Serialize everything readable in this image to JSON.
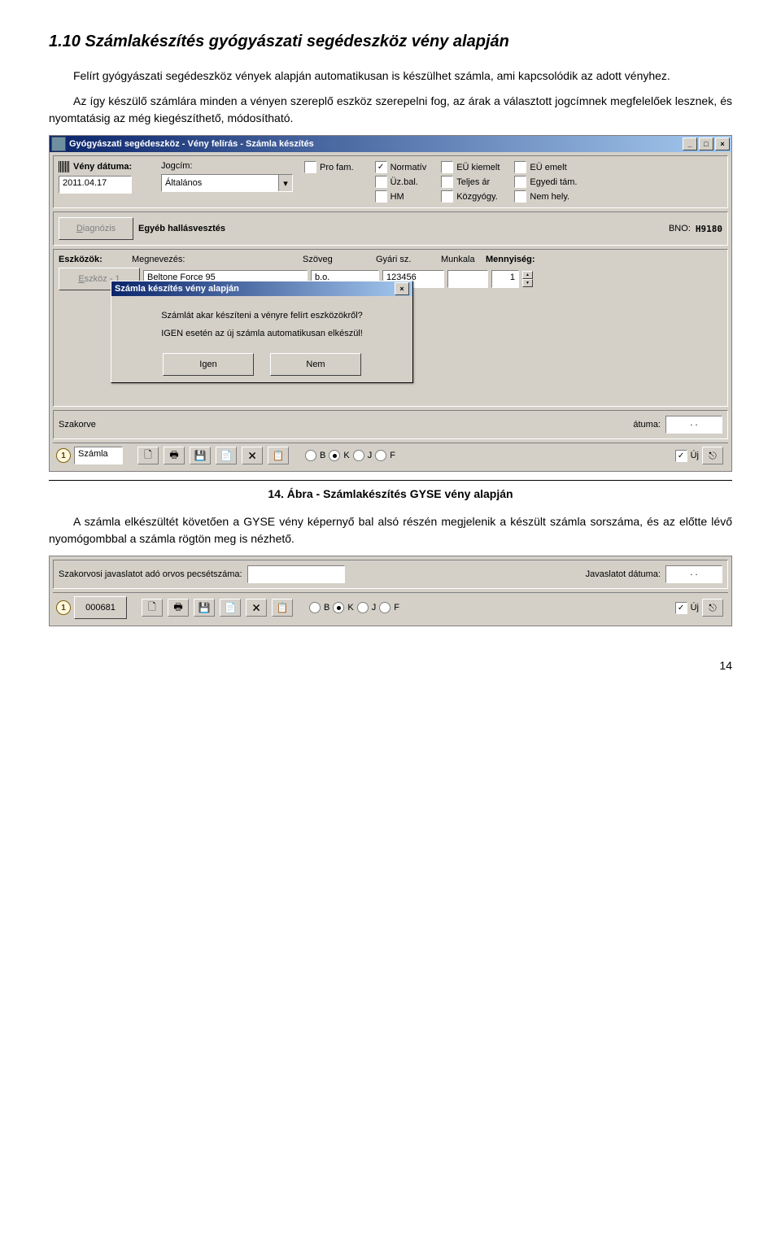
{
  "heading": "1.10 Számlakészítés gyógyászati segédeszköz vény alapján",
  "para1": "Felírt gyógyászati segédeszköz vények alapján automatikusan is készülhet számla, ami kapcsolódik az adott vényhez.",
  "para2": "Az így készülő számlára minden a vényen szereplő eszköz szerepelni fog, az árak a választott jogcímnek megfelelőek lesznek, és nyomtatásig az még kiegészíthető, módosítható.",
  "caption1": "14. Ábra - Számlakészítés GYSE vény alapján",
  "para3": "A számla elkészültét követően a GYSE vény képernyő bal alsó részén megjelenik a készült számla sorszáma, és az előtte lévő nyomógombbal a számla rögtön meg is nézhető.",
  "pagenum": "14",
  "win1": {
    "title": "Gyógyászati segédeszköz - Vény felírás - Számla készítés",
    "venydatum_lbl": "Vény dátuma:",
    "venydatum_val": "2011.04.17",
    "jogcim_lbl": "Jogcím:",
    "jogcim_val": "Általános",
    "profam": "Pro fam.",
    "chk": {
      "normativ": "Normatív",
      "eu_kiemelt": "EÜ kiemelt",
      "eu_emelt": "EÜ emelt",
      "uzbal": "Üz.bal.",
      "teljesar": "Teljes ár",
      "egyeditam": "Egyedi tám.",
      "hm": "HM",
      "kozgyogy": "Közgyógy.",
      "nemhely": "Nem hely."
    },
    "diagbtn": "Diagnózis",
    "diagtext": "Egyéb hallásvesztés",
    "bno_lbl": "BNO:",
    "bno_val": "H9180",
    "eszkozok": "Eszközök:",
    "col_megn": "Megnevezés:",
    "col_szoveg": "Szöveg",
    "col_gyari": "Gyári sz.",
    "col_munka": "Munkala",
    "col_menny": "Mennyiség:",
    "eszkozbtn": "Eszköz - 1",
    "eszk_megn": "Beltone Force 95",
    "eszk_szoveg": "b.o.",
    "eszk_gyari": "123456",
    "eszk_menny": "1",
    "szakorv": "Szakorve",
    "atuma": "átuma:",
    "dotdot": ". .",
    "szamla": "Számla",
    "uj": "Új",
    "radios": {
      "b": "B",
      "k": "K",
      "j": "J",
      "f": "F"
    },
    "dialog": {
      "title": "Számla készítés vény alapján",
      "line1": "Számlát akar készíteni a vényre felírt eszközökről?",
      "line2": "IGEN esetén az új számla automatikusan elkészül!",
      "igen": "Igen",
      "nem": "Nem"
    }
  },
  "win2": {
    "szak_lbl": "Szakorvosi javaslatot adó orvos pecsétszáma:",
    "jav_lbl": "Javaslatot dátuma:",
    "dotdot": ". .",
    "num": "000681",
    "uj": "Új",
    "radios": {
      "b": "B",
      "k": "K",
      "j": "J",
      "f": "F"
    }
  }
}
